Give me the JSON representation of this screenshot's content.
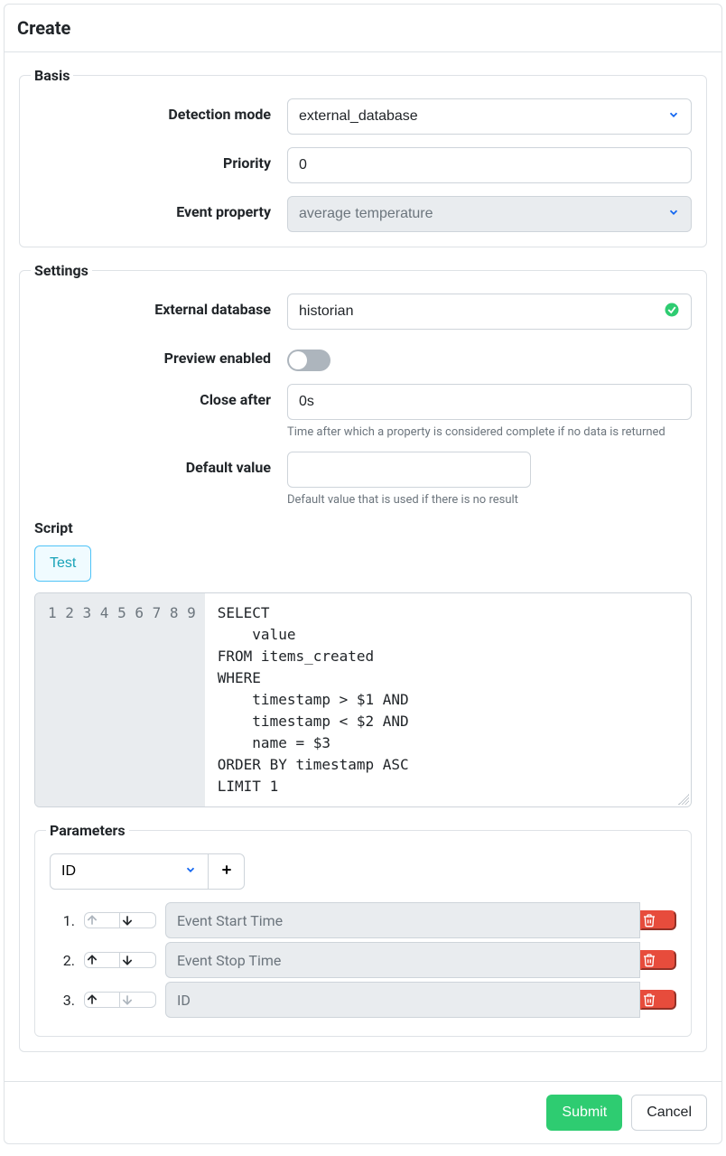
{
  "modal": {
    "title": "Create"
  },
  "basis": {
    "legend": "Basis",
    "detection_mode": {
      "label": "Detection mode",
      "value": "external_database"
    },
    "priority": {
      "label": "Priority",
      "value": "0"
    },
    "event_property": {
      "label": "Event property",
      "value": "average temperature"
    }
  },
  "settings": {
    "legend": "Settings",
    "external_database": {
      "label": "External database",
      "value": "historian"
    },
    "preview_enabled": {
      "label": "Preview enabled",
      "value": false
    },
    "close_after": {
      "label": "Close after",
      "value": "0s",
      "help": "Time after which a property is considered complete if no data is returned"
    },
    "default_value": {
      "label": "Default value",
      "value": "",
      "help": "Default value that is used if there is no result"
    }
  },
  "script": {
    "label": "Script",
    "test_label": "Test",
    "lines": [
      "SELECT",
      "    value",
      "FROM items_created",
      "WHERE",
      "    timestamp > $1 AND",
      "    timestamp < $2 AND",
      "    name = $3",
      "ORDER BY timestamp ASC",
      "LIMIT 1"
    ]
  },
  "parameters": {
    "legend": "Parameters",
    "add_select_value": "ID",
    "rows": [
      {
        "num": "1.",
        "value": "Event Start Time",
        "up_disabled": true,
        "down_disabled": false
      },
      {
        "num": "2.",
        "value": "Event Stop Time",
        "up_disabled": false,
        "down_disabled": false
      },
      {
        "num": "3.",
        "value": "ID",
        "up_disabled": false,
        "down_disabled": true
      }
    ]
  },
  "footer": {
    "submit": "Submit",
    "cancel": "Cancel"
  }
}
